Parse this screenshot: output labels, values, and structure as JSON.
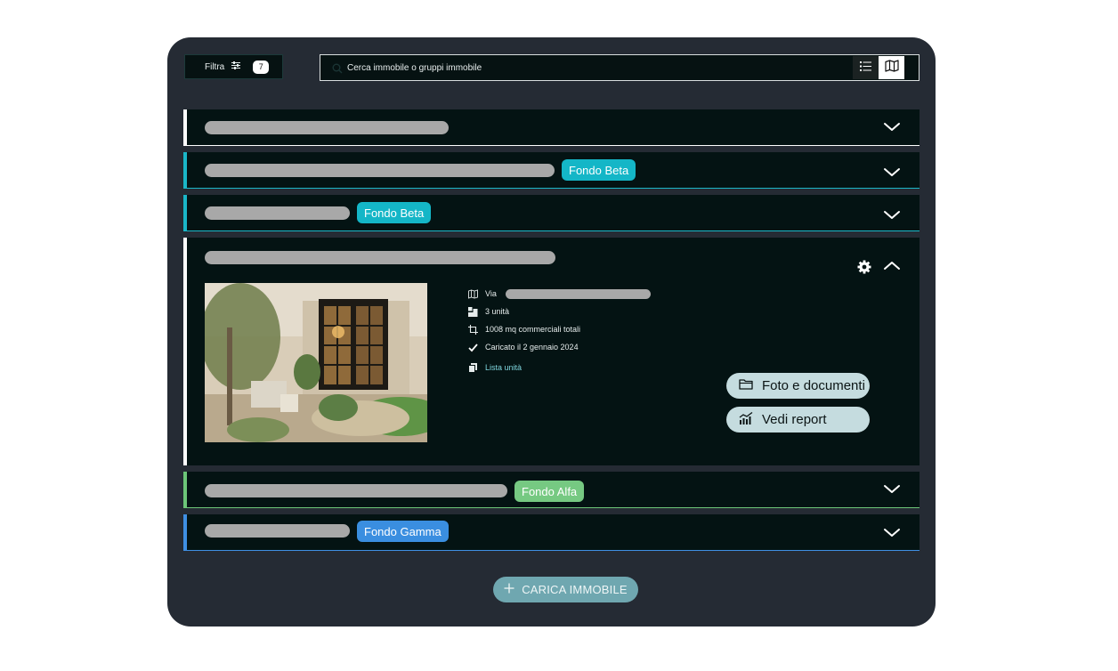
{
  "toolbar": {
    "filter_label": "Filtra",
    "filter_count": "7",
    "search_placeholder": "Cerca immobile o gruppi immobile"
  },
  "rows": [
    {
      "tag": ""
    },
    {
      "tag": "Fondo Beta"
    },
    {
      "tag": "Fondo Beta"
    },
    {
      "tag": ""
    },
    {
      "tag": "Fondo Alfa"
    },
    {
      "tag": "Fondo Gamma"
    }
  ],
  "expanded": {
    "address_prefix": "Via",
    "units": "3 unità",
    "area": "1008 mq commerciali totali",
    "uploaded": "Caricato il 2 gennaio 2024",
    "units_link": "Lista unità",
    "photos_button": "Foto e documenti",
    "report_button": "Vedi report"
  },
  "actions": {
    "add_property": "CARICA IMMOBILE"
  },
  "colors": {
    "panel": "#252b34",
    "row_bg": "#041313",
    "fondo_beta": "#14b6c7",
    "fondo_alfa": "#76c982",
    "fondo_gamma": "#3a8ee0",
    "placeholder_bar": "#a8a8a8"
  }
}
